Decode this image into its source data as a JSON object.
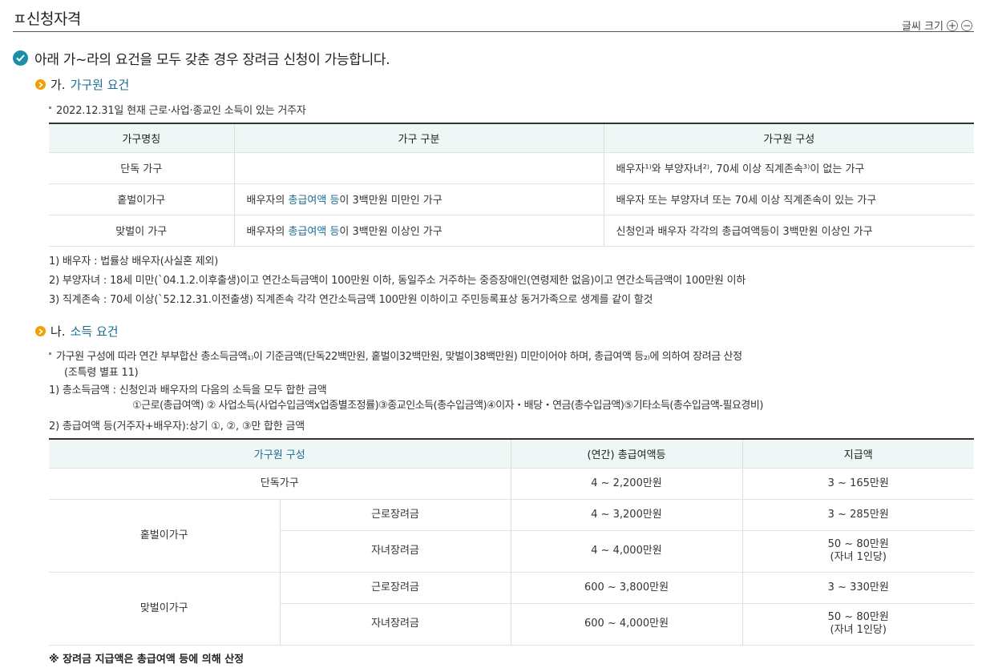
{
  "page": {
    "title": "ㅍ신청자격"
  },
  "font_size": {
    "label": "글씨 크기",
    "plus": "+",
    "minus": "−"
  },
  "lead": "아래 가~라의 요건을 모두 갖춘 경우 장려금 신청이 가능합니다.",
  "section_a": {
    "prefix": "가.",
    "title": "가구원 요건",
    "bullet": "2022.12.31일 현재 근로·사업·종교인 소득이 있는 거주자",
    "table": {
      "headers": [
        "가구명칭",
        "가구 구분",
        "가구원 구성"
      ],
      "rows": [
        {
          "name": "단독 가구",
          "type_pre": "",
          "type_hl": "",
          "type_post": "",
          "composition": "배우자¹⁾와 부양자녀²⁾, 70세 이상 직계존속³⁾이 없는 가구"
        },
        {
          "name": "홑벌이가구",
          "type_pre": "배우자의 ",
          "type_hl": "총급여액 등",
          "type_post": "이 3백만원 미만인 가구",
          "composition": "배우자 또는 부양자녀 또는 70세 이상 직계존속이 있는 가구"
        },
        {
          "name": "맞벌이 가구",
          "type_pre": "배우자의 ",
          "type_hl": "총급여액 등",
          "type_post": "이 3백만원 이상인 가구",
          "composition": "신청인과 배우자 각각의 총급여액등이 3백만원 이상인 가구"
        }
      ]
    },
    "notes": [
      "1) 배우자 : 법률상 배우자(사실혼 제외)",
      "2) 부양자녀 : 18세 미만(`04.1.2.이후출생)이고 연간소득금액이 100만원 이하, 동일주소 거주하는 중증장애인(연령제한 없음)이고 연간소득금액이 100만원 이하",
      "3) 직계존속 : 70세 이상(`52.12.31.이전출생) 직계존속 각각 연간소득금액 100만원 이하이고 주민등록표상 동거가족으로 생계를 같이 할것"
    ]
  },
  "section_b": {
    "prefix": "나.",
    "title": "소득 요건",
    "bullet_line1": "가구원 구성에 따라 연간 부부합산 총소득금액₁₎이 기준금액(단독22백만원, 홑벌이32백만원, 맞벌이38백만원) 미만이어야 하며, 총급여액 등₂₎에 의하여 장려금 산정",
    "bullet_line2": "(조특령 별표 11)",
    "note1": "1) 총소득금액 : 신청인과 배우자의 다음의 소득을 모두 합한 금액",
    "note1_detail": "①근로(총급여액) ② 사업소득(사업수입금액x업종별조정률)③종교인소득(총수입금액)④이자・배당・연금(총수입금액)⑤기타소득(총수입금액-필요경비)",
    "note2": "2) 총급여액 등(거주자+배우자):상기 ①, ②, ③만 합한 금액",
    "table": {
      "headers": [
        "가구원 구성",
        "(연간) 총급여액등",
        "지급액"
      ],
      "single": {
        "name": "단독가구",
        "income": "4 ~ 2,200만원",
        "amount": "3 ~ 165만원"
      },
      "hotbeori": {
        "name": "홑벌이가구",
        "rows": [
          {
            "kind": "근로장려금",
            "income": "4 ~ 3,200만원",
            "amount": "3 ~ 285만원",
            "amount_sub": ""
          },
          {
            "kind": "자녀장려금",
            "income": "4 ~ 4,000만원",
            "amount": "50 ~ 80만원",
            "amount_sub": "(자녀 1인당)"
          }
        ]
      },
      "matbeori": {
        "name": "맞벌이가구",
        "rows": [
          {
            "kind": "근로장려금",
            "income": "600 ~ 3,800만원",
            "amount": "3 ~ 330만원",
            "amount_sub": ""
          },
          {
            "kind": "자녀장려금",
            "income": "600 ~ 4,000만원",
            "amount": "50 ~ 80만원",
            "amount_sub": "(자녀 1인당)"
          }
        ]
      }
    },
    "footnote": "※ 장려금 지급액은 총급여액 등에 의해 산정"
  }
}
